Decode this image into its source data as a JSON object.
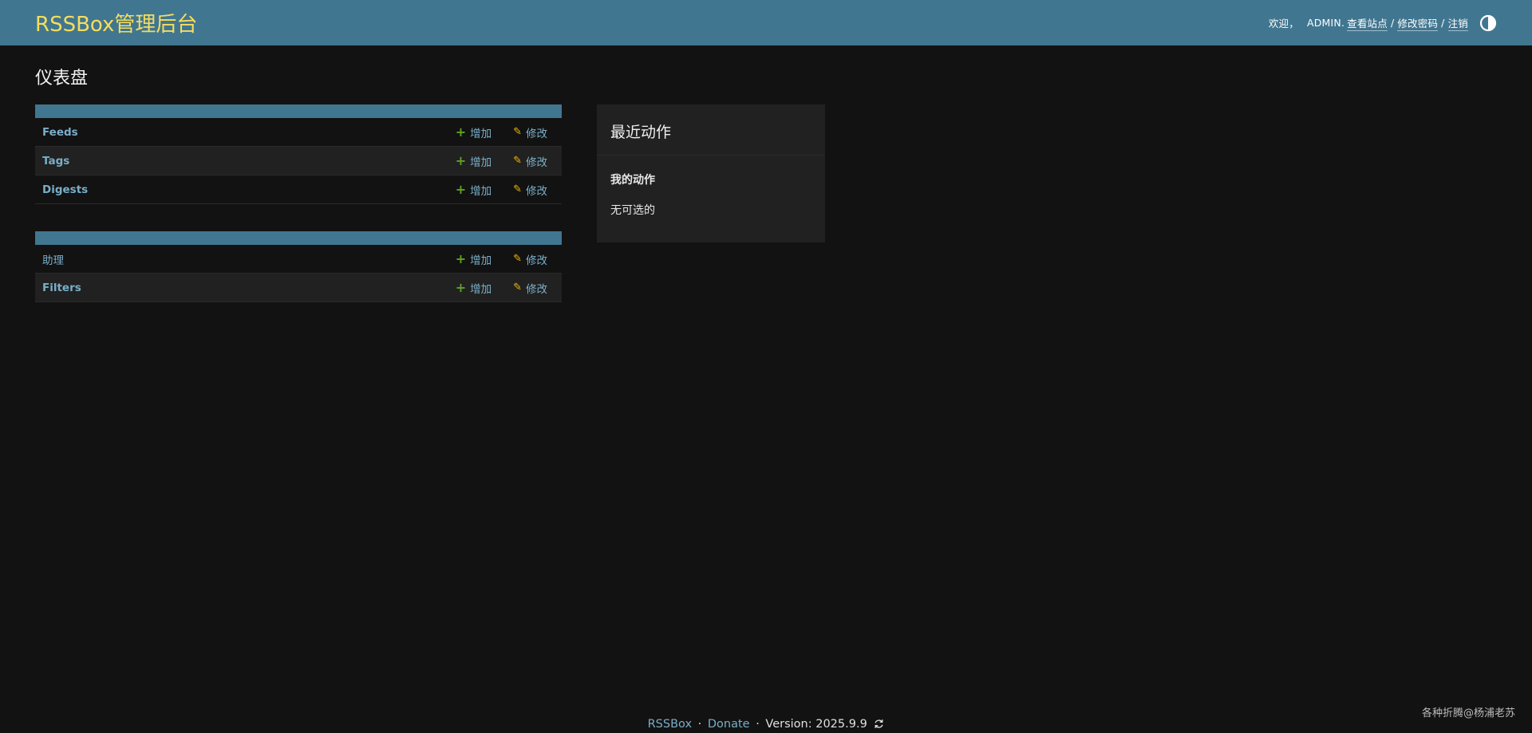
{
  "header": {
    "brand": "RSSBox管理后台",
    "welcome": "欢迎，",
    "username": "ADMIN.",
    "view_site": "查看站点",
    "separator": "/",
    "change_password": "修改密码",
    "logout": "注销",
    "theme_icon": "contrast-toggle-icon"
  },
  "page": {
    "title": "仪表盘"
  },
  "modules": [
    {
      "caption": "",
      "rows": [
        {
          "name": "Feeds",
          "add": "增加",
          "change": "修改"
        },
        {
          "name": "Tags",
          "add": "增加",
          "change": "修改"
        },
        {
          "name": "Digests",
          "add": "增加",
          "change": "修改"
        }
      ]
    },
    {
      "caption": "",
      "rows": [
        {
          "name": "助理",
          "add": "增加",
          "change": "修改"
        },
        {
          "name": "Filters",
          "add": "增加",
          "change": "修改"
        }
      ]
    }
  ],
  "recent_actions": {
    "title": "最近动作",
    "subtitle": "我的动作",
    "empty": "无可选的"
  },
  "footer": {
    "brand_link": "RSSBox",
    "donate_link": "Donate",
    "version": "Version: 2025.9.9",
    "refresh_icon": "refresh-icon",
    "dot": "·"
  },
  "watermark": "各种折腾@杨浦老苏",
  "colors": {
    "header_bg": "#417690",
    "brand": "#f5dd5d",
    "link": "#79aec8",
    "add_icon": "#5fa225",
    "change_icon": "#efb80b",
    "page_bg": "#121212"
  }
}
